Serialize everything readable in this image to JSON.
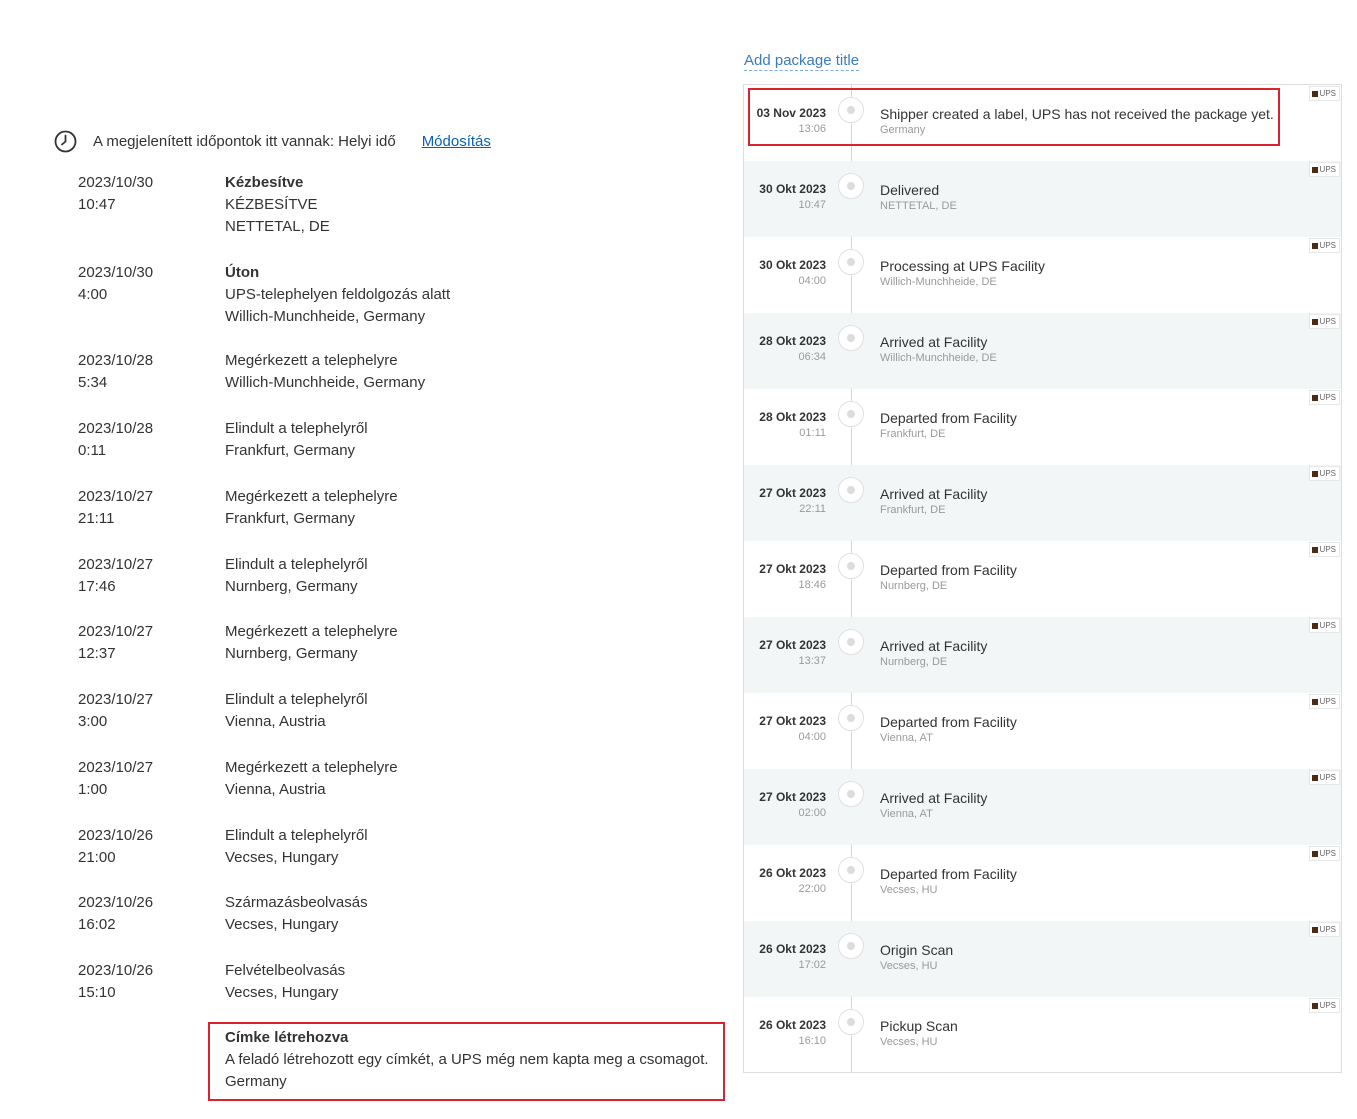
{
  "left": {
    "timezone_text": "A megjelenített időpontok itt vannak: Helyi idő",
    "timezone_link": "Módosítás",
    "rows": [
      {
        "date": "2023/10/30",
        "time": "10:47",
        "line1": "Kézbesítve",
        "line2": "KÉZBESÍTVE",
        "line3": "NETTETAL, DE"
      },
      {
        "date": "2023/10/30",
        "time": "4:00",
        "line1": "Úton",
        "line2": "UPS-telephelyen feldolgozás alatt",
        "line3": "Willich-Munchheide, Germany"
      },
      {
        "date": "2023/10/28",
        "time": "5:34",
        "line1": "Megérkezett a telephelyre",
        "line2": "Willich-Munchheide, Germany"
      },
      {
        "date": "2023/10/28",
        "time": "0:11",
        "line1": "Elindult a telephelyről",
        "line2": "Frankfurt, Germany"
      },
      {
        "date": "2023/10/27",
        "time": "21:11",
        "line1": "Megérkezett a telephelyre",
        "line2": "Frankfurt, Germany"
      },
      {
        "date": "2023/10/27",
        "time": "17:46",
        "line1": "Elindult a telephelyről",
        "line2": "Nurnberg, Germany"
      },
      {
        "date": "2023/10/27",
        "time": "12:37",
        "line1": "Megérkezett a telephelyre",
        "line2": "Nurnberg, Germany"
      },
      {
        "date": "2023/10/27",
        "time": "3:00",
        "line1": "Elindult a telephelyről",
        "line2": "Vienna, Austria"
      },
      {
        "date": "2023/10/27",
        "time": "1:00",
        "line1": "Megérkezett a telephelyre",
        "line2": "Vienna, Austria"
      },
      {
        "date": "2023/10/26",
        "time": "21:00",
        "line1": "Elindult a telephelyről",
        "line2": "Vecses, Hungary"
      },
      {
        "date": "2023/10/26",
        "time": "16:02",
        "line1": "Származásbeolvasás",
        "line2": "Vecses, Hungary"
      },
      {
        "date": "2023/10/26",
        "time": "15:10",
        "line1": "Felvételbeolvasás",
        "line2": "Vecses, Hungary"
      },
      {
        "date": "",
        "time": "",
        "line1": "Címke létrehozva",
        "line2": "A feladó létrehozott egy címkét, a UPS még nem kapta meg a csomagot.",
        "line3": "Germany"
      }
    ]
  },
  "right": {
    "add_title_label": "Add package title",
    "badge_label": "UPS",
    "events": [
      {
        "date": "03 Nov 2023",
        "time": "13:06",
        "status": "Shipper created a label, UPS has not received the package yet.",
        "location": "Germany"
      },
      {
        "date": "30 Okt 2023",
        "time": "10:47",
        "status": "Delivered",
        "location": "NETTETAL, DE"
      },
      {
        "date": "30 Okt 2023",
        "time": "04:00",
        "status": "Processing at UPS Facility",
        "location": "Willich-Munchheide, DE"
      },
      {
        "date": "28 Okt 2023",
        "time": "06:34",
        "status": "Arrived at Facility",
        "location": "Willich-Munchheide, DE"
      },
      {
        "date": "28 Okt 2023",
        "time": "01:11",
        "status": "Departed from Facility",
        "location": "Frankfurt, DE"
      },
      {
        "date": "27 Okt 2023",
        "time": "22:11",
        "status": "Arrived at Facility",
        "location": "Frankfurt, DE"
      },
      {
        "date": "27 Okt 2023",
        "time": "18:46",
        "status": "Departed from Facility",
        "location": "Nurnberg, DE"
      },
      {
        "date": "27 Okt 2023",
        "time": "13:37",
        "status": "Arrived at Facility",
        "location": "Nurnberg, DE"
      },
      {
        "date": "27 Okt 2023",
        "time": "04:00",
        "status": "Departed from Facility",
        "location": "Vienna, AT"
      },
      {
        "date": "27 Okt 2023",
        "time": "02:00",
        "status": "Arrived at Facility",
        "location": "Vienna, AT"
      },
      {
        "date": "26 Okt 2023",
        "time": "22:00",
        "status": "Departed from Facility",
        "location": "Vecses, HU"
      },
      {
        "date": "26 Okt 2023",
        "time": "17:02",
        "status": "Origin Scan",
        "location": "Vecses, HU"
      },
      {
        "date": "26 Okt 2023",
        "time": "16:10",
        "status": "Pickup Scan",
        "location": "Vecses, HU"
      }
    ]
  }
}
